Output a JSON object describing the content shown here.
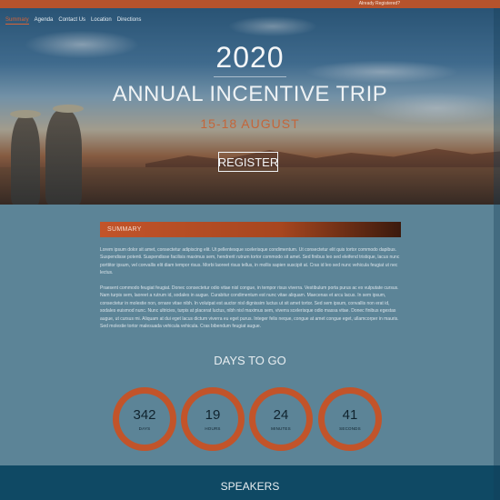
{
  "topbar": {
    "already_registered": "Already Registered?"
  },
  "nav": {
    "items": [
      "Summary",
      "Agenda",
      "Contact Us",
      "Location",
      "Directions"
    ]
  },
  "hero": {
    "year": "2020",
    "title": "ANNUAL INCENTIVE TRIP",
    "dates": "15-18 AUGUST",
    "register_label": "REGISTER"
  },
  "summary": {
    "heading": "SUMMARY",
    "paragraph1": "Lorem ipsum dolor sit amet, consectetur adipiscing elit. Ut pellentesque scelerisque condimentum. Ut consectetur elit quis tortor commodo dapibus. Suspendisse potenti. Suspendisse facilisis maximus sem, hendrerit rutrum tortor commodo sit amet. Sed finibus leo sed eleifend tristique, lacus nunc porttitor ipsum, vel convallis elit diam tempor risus. Morbi laoreet risus tellus, in mollis sapien suscipit at. Cras id leo sed nunc vehicula feugiat ut nec lectus.",
    "paragraph2": "Praesent commodo feugiat feugiat. Donec consectetur odio vitae nisl congue, in tempor risus viverra. Vestibulum porta purus ac ex vulputate cursus. Nam turpis sem, laoreet a rutrum id, sodales in augue. Curabitur condimentum est nunc vitae aliquam. Maecenas et arcu lacus. In sem ipsum, consectetur in molestie non, ornare vitae nibh. In volutpat est auctor nisl dignissim luctus ut sit amet tortor. Sed sem ipsum, convallis non erat id, sodales euismod nunc. Nunc ultricies, turpis at placerat luctus, nibh nisl maximus sem, viverra scelerisque odio massa vitae. Donec finibus egestas augue, ut cursus mi. Aliquam at dui eget lacus dictum viverra eu eget purus. Integer felis neque, congue at amet congue eget, ullamcorper in mauris. Sed molestie tortor malesuada vehicula vehicula. Cras bibendum feugiat augue."
  },
  "countdown": {
    "title": "DAYS TO GO",
    "items": [
      {
        "value": "342",
        "label": "DAYS"
      },
      {
        "value": "19",
        "label": "HOURS"
      },
      {
        "value": "24",
        "label": "MINUTES"
      },
      {
        "value": "41",
        "label": "SECONDS"
      }
    ]
  },
  "speakers": {
    "title": "SPEAKERS"
  },
  "colors": {
    "accent": "#c2542a",
    "page_background": "#5c8497",
    "speakers_band": "#0f4964"
  }
}
